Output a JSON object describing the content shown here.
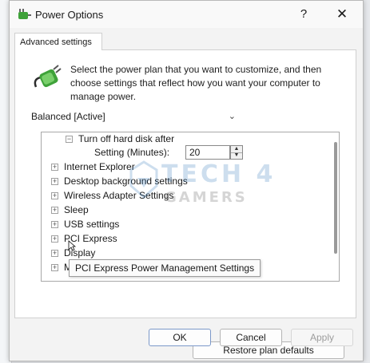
{
  "window": {
    "title": "Power Options",
    "help_glyph": "?",
    "close_glyph": "✕"
  },
  "tab": {
    "label": "Advanced settings"
  },
  "description": "Select the power plan that you want to customize, and then choose settings that reflect how you want your computer to manage power.",
  "plan": {
    "selected": "Balanced [Active]"
  },
  "tree": {
    "subitem_label": "Turn off hard disk after",
    "setting": {
      "label": "Setting (Minutes):",
      "value": "20"
    },
    "items": [
      {
        "label": "Internet Explorer",
        "expander": "+"
      },
      {
        "label": "Desktop background settings",
        "expander": "+"
      },
      {
        "label": "Wireless Adapter Settings",
        "expander": "+"
      },
      {
        "label": "Sleep",
        "expander": "+"
      },
      {
        "label": "USB settings",
        "expander": "+"
      },
      {
        "label": "PCI Express",
        "expander": "+"
      },
      {
        "label": "Display",
        "expander": "+"
      },
      {
        "label": "M",
        "expander": "+"
      }
    ],
    "sub_expander": "−"
  },
  "tooltip": "PCI Express Power Management Settings",
  "buttons": {
    "restore": "Restore plan defaults",
    "ok": "OK",
    "cancel": "Cancel",
    "apply": "Apply"
  },
  "watermark": {
    "line1": "TECH 4",
    "line2": "GAMERS"
  },
  "colors": {
    "accent": "#1f6fb7",
    "icon_green": "#3fa23a"
  }
}
